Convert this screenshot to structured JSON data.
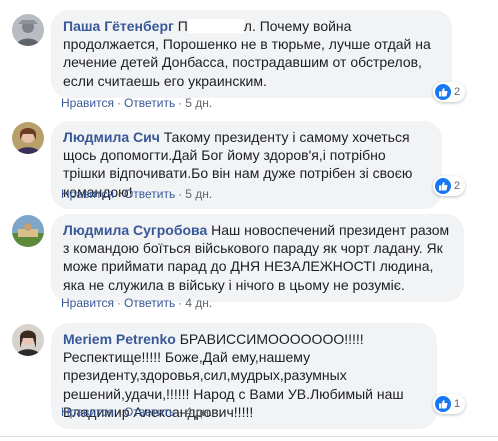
{
  "comments": [
    {
      "author": "Паша Гётенберг",
      "text_before": "П",
      "text_after": "л. Почему война продолжается, Порошенко не в тюрьме, лучше отдай на лечение детей Донбасса, пострадавшим от обстрелов, если считаешь его украинским.",
      "like_label": "Нравится",
      "reply_label": "Ответить",
      "time": "5 дн.",
      "reaction_count": "2"
    },
    {
      "author": "Людмила Сич",
      "text": "Такому президенту і самому хочеться щось допомогти.Дай Бог йому здоров'я,і потрібно трішки відпочивати.Бо він нам дуже потрібен зі своєю командою!",
      "like_label": "Нравится",
      "reply_label": "Ответить",
      "time": "5 дн.",
      "reaction_count": "2"
    },
    {
      "author": "Людмила Сугробова",
      "text": "Наш новоспечений президент разом з командою боїться військового параду як чорт ладану. Як може приймати парад до ДНЯ НЕЗАЛЕЖНОСТІ людина, яка не служила в війську і нічого в цьому не розуміє.",
      "like_label": "Нравится",
      "reply_label": "Ответить",
      "time": "4 дн."
    },
    {
      "author": "Meriem Petrenko",
      "text": "БРАВИССИМООООООО!!!!!Респектище!!!!! Боже,Дай ему,нашему президенту,здоровья,сил,мудрых,разумных решений,удачи,!!!!!! Народ с Вами УВ.Любимый наш Владимир Александрович!!!!!",
      "like_label": "Нравится",
      "reply_label": "Ответить",
      "time": "4 дн.",
      "reaction_count": "1"
    }
  ],
  "colors": {
    "author": "#385898",
    "bubble": "#f2f3f5",
    "like": "#1877f2"
  }
}
